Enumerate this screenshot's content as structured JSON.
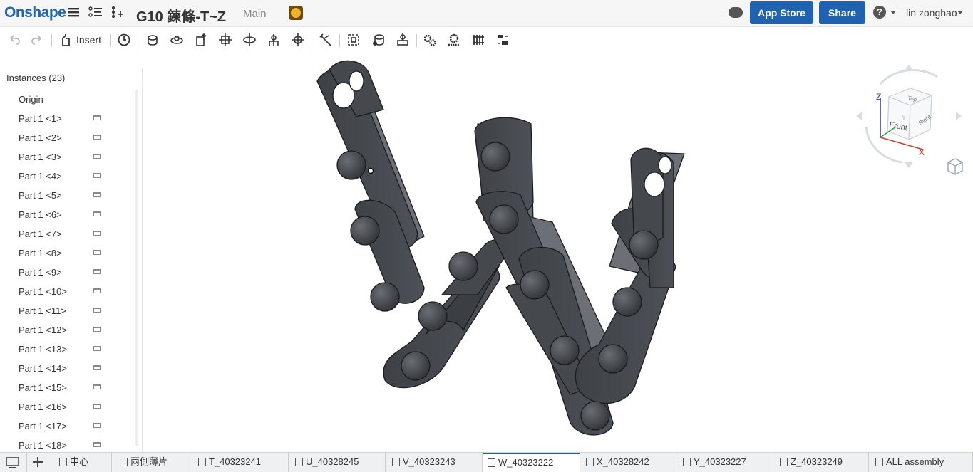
{
  "header": {
    "logo": "Onshape",
    "doc_title": "G10 鍊條-T~Z",
    "branch": "Main",
    "app_store": "App Store",
    "share": "Share",
    "help": "?",
    "user": "lin zonghao"
  },
  "toolbar": {
    "insert_label": "Insert",
    "tools": [
      "undo-icon",
      "redo-icon",
      "insert-icon",
      "history-icon",
      "fastened-mate-icon",
      "revolute-mate-icon",
      "slider-mate-icon",
      "planar-mate-icon",
      "cylindrical-mate-icon",
      "pin-slot-mate-icon",
      "ball-mate-icon",
      "tangent-mate-icon",
      "group-icon",
      "replicate-icon",
      "mate-connector-icon",
      "gear-relation-icon",
      "rack-pinion-icon",
      "screw-relation-icon",
      "linear-relation-icon"
    ]
  },
  "panel": {
    "heading": "Instances (23)",
    "items": [
      {
        "label": "Origin",
        "mate": false
      },
      {
        "label": "Part 1 <1>",
        "mate": true
      },
      {
        "label": "Part 1 <2>",
        "mate": true
      },
      {
        "label": "Part 1 <3>",
        "mate": true
      },
      {
        "label": "Part 1 <4>",
        "mate": true
      },
      {
        "label": "Part 1 <5>",
        "mate": true
      },
      {
        "label": "Part 1 <6>",
        "mate": true
      },
      {
        "label": "Part 1 <7>",
        "mate": true
      },
      {
        "label": "Part 1 <8>",
        "mate": true
      },
      {
        "label": "Part 1 <9>",
        "mate": true
      },
      {
        "label": "Part 1 <10>",
        "mate": true
      },
      {
        "label": "Part 1 <11>",
        "mate": true
      },
      {
        "label": "Part 1 <12>",
        "mate": true
      },
      {
        "label": "Part 1 <13>",
        "mate": true
      },
      {
        "label": "Part 1 <14>",
        "mate": true
      },
      {
        "label": "Part 1 <15>",
        "mate": true
      },
      {
        "label": "Part 1 <16>",
        "mate": true
      },
      {
        "label": "Part 1 <17>",
        "mate": true
      },
      {
        "label": "Part 1 <18>",
        "mate": true
      }
    ]
  },
  "viewcube": {
    "top": "Top",
    "front": "Front",
    "right": "Right",
    "z": "Z",
    "x": "X",
    "y": "Y"
  },
  "tabs": [
    {
      "label": "中心"
    },
    {
      "label": "兩側薄片"
    },
    {
      "label": "T_40323241"
    },
    {
      "label": "U_40328245"
    },
    {
      "label": "V_40323243"
    },
    {
      "label": "W_40323222",
      "active": true
    },
    {
      "label": "X_40328242"
    },
    {
      "label": "Y_40323227"
    },
    {
      "label": "Z_40323249"
    },
    {
      "label": "ALL assembly"
    }
  ],
  "colors": {
    "brand": "#1f63b0",
    "part": "#4a4d52"
  }
}
